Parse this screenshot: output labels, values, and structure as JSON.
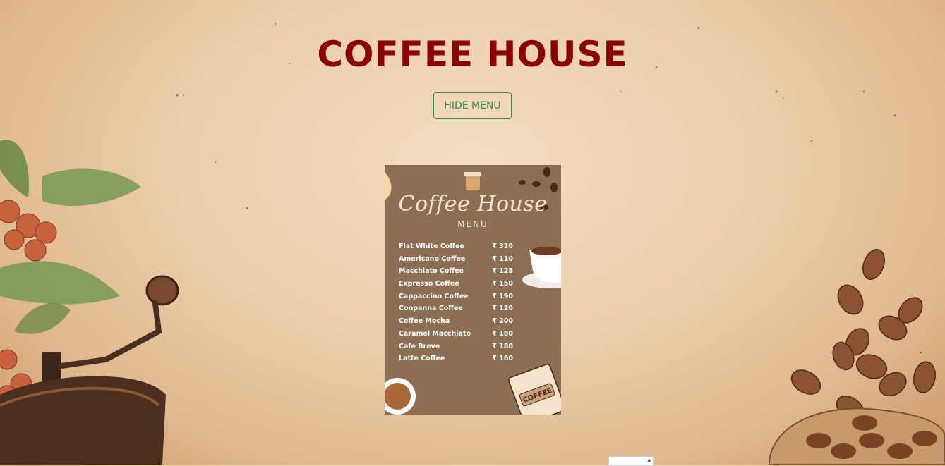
{
  "page": {
    "title": "COFFEE HOUSE"
  },
  "toolbar": {
    "hide_menu_label": "HIDE MENU"
  },
  "menu": {
    "card_title": "Coffee House",
    "card_subtitle": "MENU",
    "items": [
      {
        "name": "Flat White Coffee",
        "price": "₹ 320"
      },
      {
        "name": "Americano Coffee",
        "price": "₹ 110"
      },
      {
        "name": "Macchiato Coffee",
        "price": "₹ 125"
      },
      {
        "name": "Expresso Coffee",
        "price": "₹ 150"
      },
      {
        "name": "Cappaccino Coffee",
        "price": "₹ 190"
      },
      {
        "name": "Conpanna Coffee",
        "price": "₹ 120"
      },
      {
        "name": "Coffee Mocha",
        "price": "₹ 200"
      },
      {
        "name": "Caramel Macchiato",
        "price": "₹ 180"
      },
      {
        "name": "Cafe Breve",
        "price": "₹ 180"
      },
      {
        "name": "Latte Coffee",
        "price": "₹ 160"
      }
    ],
    "bag_label": "COFFEE"
  },
  "colors": {
    "title": "#8b0000",
    "button": "#2e8b57",
    "card": "#8c6e55"
  }
}
